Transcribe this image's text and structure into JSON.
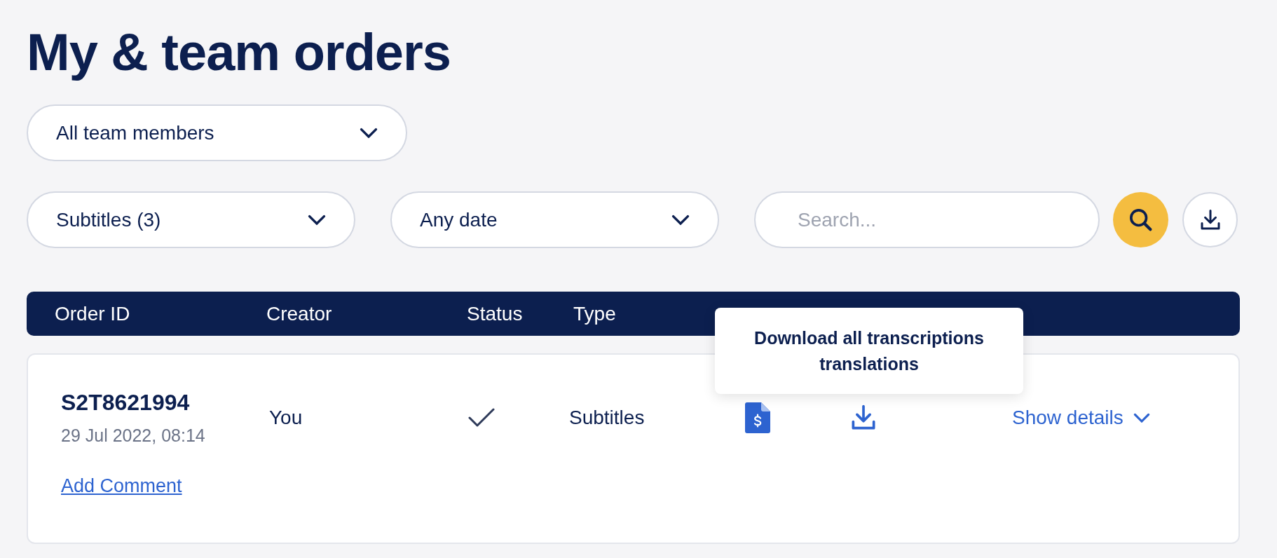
{
  "page_title": "My & team orders",
  "member_select": {
    "value": "All team members"
  },
  "filters": [
    {
      "value": "Subtitles (3)"
    },
    {
      "value": "Any date"
    }
  ],
  "search": {
    "placeholder": "Search..."
  },
  "table": {
    "columns": [
      "Order ID",
      "Creator",
      "Status",
      "Type"
    ],
    "rows": [
      {
        "order_id": "S2T8621994",
        "date": "29 Jul 2022, 08:14",
        "creator": "You",
        "completed": true,
        "type": "Subtitles",
        "details_link": "Show details",
        "comment_link": "Add Comment"
      }
    ]
  },
  "tooltip": {
    "text": "Download all transcriptions translations"
  }
}
